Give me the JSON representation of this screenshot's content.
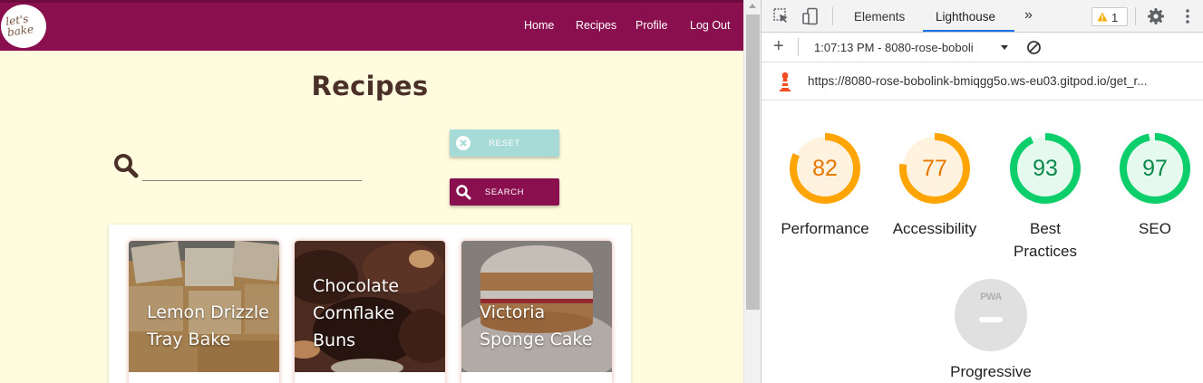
{
  "site": {
    "logo_text": "let's bake",
    "nav": {
      "home": "Home",
      "recipes": "Recipes",
      "profile": "Profile",
      "logout": "Log Out"
    },
    "page_title": "Recipes",
    "search": {
      "placeholder": "",
      "value": "",
      "icon": "search-icon"
    },
    "buttons": {
      "reset": "RESET",
      "search": "SEARCH"
    },
    "recipes": [
      {
        "title_lines": [
          "Lemon Drizzle",
          "Tray Bake"
        ]
      },
      {
        "title_lines": [
          "Chocolate",
          "Cornflake",
          "Buns"
        ]
      },
      {
        "title_lines": [
          "Victoria",
          "Sponge Cake"
        ]
      }
    ],
    "colors": {
      "brand": "#8a0f4f",
      "background": "#fffbdf",
      "reset": "#a6dbd8",
      "heading": "#4a3028"
    }
  },
  "devtools": {
    "tabs": [
      "Elements",
      "Lighthouse"
    ],
    "active_tab": "Lighthouse",
    "more_tabs": "»",
    "warnings_count": "1",
    "report_select": "1:07:13 PM - 8080-rose-boboli",
    "report_url": "https://8080-rose-bobolink-bmiqgg5o.ws-eu03.gitpod.io/get_r...",
    "scores": [
      {
        "label": "Performance",
        "value": 82,
        "color": "#ffa400",
        "bg": "#fff3e0"
      },
      {
        "label": "Accessibility",
        "value": 77,
        "color": "#ffa400",
        "bg": "#fff3e0"
      },
      {
        "label": "Best Practices",
        "value": 93,
        "color": "#0cce6b",
        "bg": "#e6f9ef"
      },
      {
        "label": "SEO",
        "value": 97,
        "color": "#0cce6b",
        "bg": "#e6f9ef"
      }
    ],
    "pwa": {
      "badge_text": "PWA",
      "label": "Progressive"
    }
  }
}
